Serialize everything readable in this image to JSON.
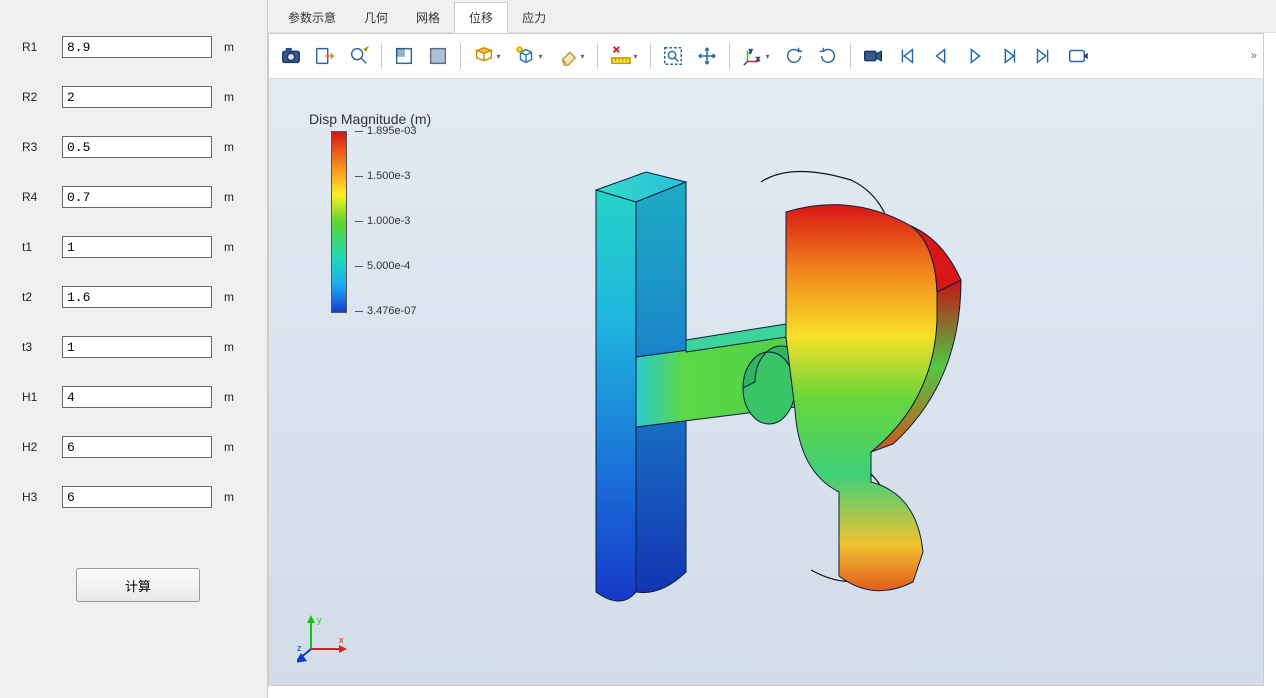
{
  "params": [
    {
      "label": "R1",
      "value": "8.9",
      "unit": "m"
    },
    {
      "label": "R2",
      "value": "2",
      "unit": "m"
    },
    {
      "label": "R3",
      "value": "0.5",
      "unit": "m"
    },
    {
      "label": "R4",
      "value": "0.7",
      "unit": "m"
    },
    {
      "label": "t1",
      "value": "1",
      "unit": "m"
    },
    {
      "label": "t2",
      "value": "1.6",
      "unit": "m"
    },
    {
      "label": "t3",
      "value": "1",
      "unit": "m"
    },
    {
      "label": "H1",
      "value": "4",
      "unit": "m"
    },
    {
      "label": "H2",
      "value": "6",
      "unit": "m"
    },
    {
      "label": "H3",
      "value": "6",
      "unit": "m"
    }
  ],
  "buttons": {
    "calculate": "计算"
  },
  "tabs": {
    "items": [
      "参数示意",
      "几何",
      "网格",
      "位移",
      "应力"
    ],
    "active_index": 3
  },
  "toolbar": {
    "items": [
      "camera-icon",
      "export-icon",
      "zoom-search-icon",
      "sep",
      "select-rect-icon",
      "select-face-icon",
      "sep",
      "select-mode-icon",
      "visibility-cube-icon",
      "eraser-icon",
      "sep",
      "ruler-x-icon",
      "sep",
      "zoom-fit-icon",
      "pan-icon",
      "sep",
      "axes-icon",
      "rotate-ccw-icon",
      "rotate-cw-icon",
      "sep",
      "video-camera-icon",
      "skip-start-icon",
      "step-back-icon",
      "play-icon",
      "step-fwd-icon",
      "skip-end-icon",
      "loop-icon"
    ],
    "overflow": "»"
  },
  "legend": {
    "title": "Disp Magnitude (m)",
    "ticks": [
      {
        "label": "1.895e-03",
        "pos": 0
      },
      {
        "label": "1.500e-3",
        "pos": 25
      },
      {
        "label": "1.000e-3",
        "pos": 50
      },
      {
        "label": "5.000e-4",
        "pos": 75
      },
      {
        "label": "3.476e-07",
        "pos": 100
      }
    ]
  },
  "triad": {
    "x": "x",
    "y": "y",
    "z": "z"
  }
}
